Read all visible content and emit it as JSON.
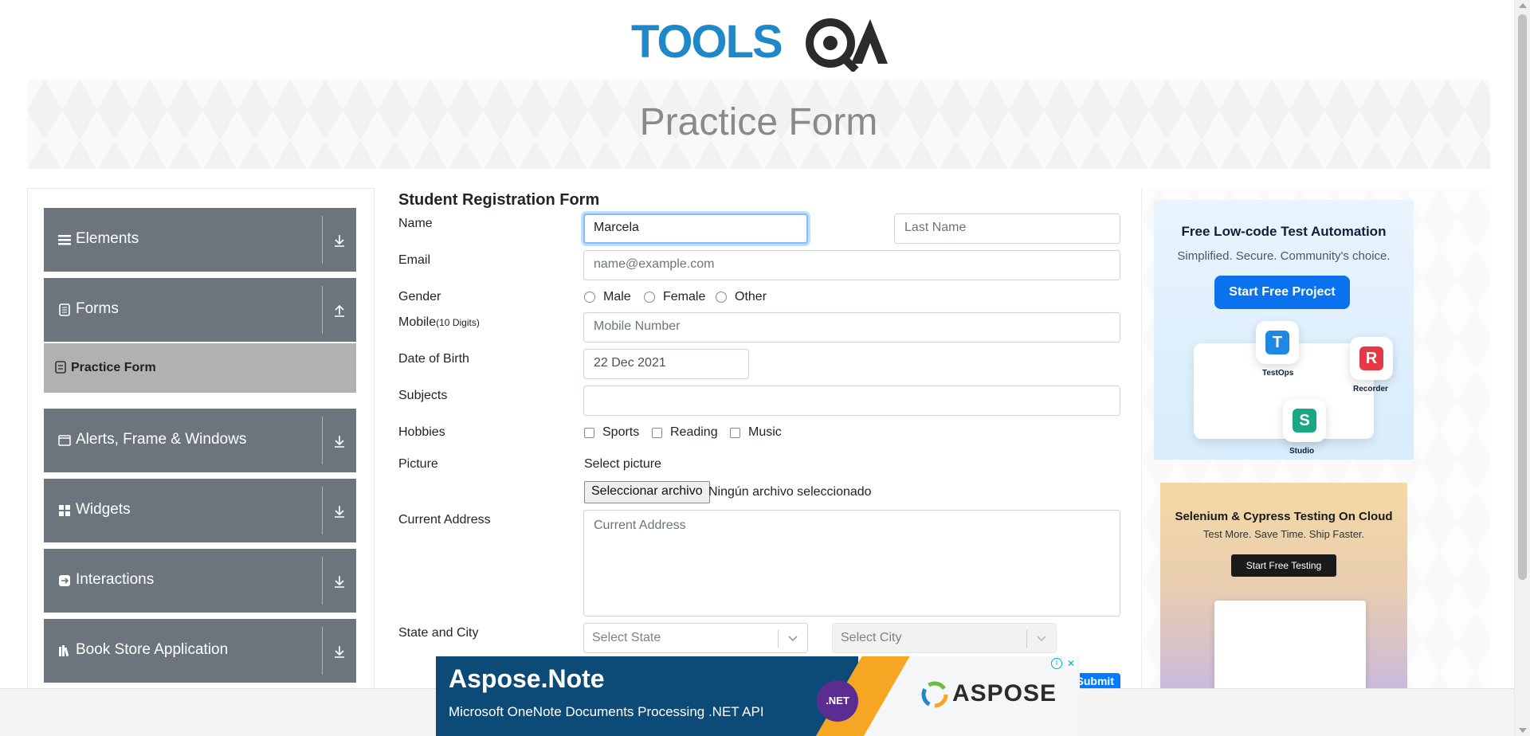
{
  "header": {
    "logo_text": "TOOLSQA",
    "page_title": "Practice Form"
  },
  "sidebar": {
    "groups": [
      {
        "label": "Elements",
        "icon": "hamburger-icon",
        "arrow": "download-icon"
      },
      {
        "label": "Forms",
        "icon": "document-icon",
        "arrow": "upload-icon"
      },
      {
        "label": "Alerts, Frame & Windows",
        "icon": "window-icon",
        "arrow": "download-icon"
      },
      {
        "label": "Widgets",
        "icon": "grid-icon",
        "arrow": "download-icon"
      },
      {
        "label": "Interactions",
        "icon": "interaction-icon",
        "arrow": "download-icon"
      },
      {
        "label": "Book Store Application",
        "icon": "books-icon",
        "arrow": "download-icon"
      }
    ],
    "active_item": {
      "label": "Practice Form",
      "icon": "form-icon"
    }
  },
  "form": {
    "title": "Student Registration Form",
    "name_label": "Name",
    "first_name_value": "Marcela",
    "last_name_placeholder": "Last Name",
    "email_label": "Email",
    "email_placeholder": "name@example.com",
    "gender_label": "Gender",
    "genders": [
      "Male",
      "Female",
      "Other"
    ],
    "mobile_label": "Mobile",
    "mobile_hint": "(10 Digits)",
    "mobile_placeholder": "Mobile Number",
    "dob_label": "Date of Birth",
    "dob_value": "22 Dec 2021",
    "subjects_label": "Subjects",
    "subjects_value": "",
    "hobbies_label": "Hobbies",
    "hobbies": [
      "Sports",
      "Reading",
      "Music"
    ],
    "picture_label": "Picture",
    "select_picture_label": "Select picture",
    "file_button": "Seleccionar archivo",
    "file_status": "Ningún archivo seleccionado",
    "address_label": "Current Address",
    "address_placeholder": "Current Address",
    "state_city_label": "State and City",
    "state_placeholder": "Select State",
    "city_placeholder": "Select City",
    "submit_label": "Submit"
  },
  "ads": {
    "testproject": {
      "title": "Free Low-code Test Automation",
      "subtitle": "Simplified. Secure. Community's choice.",
      "button": "Start Free Project",
      "badges": [
        "TestOps",
        "Recorder",
        "Studio"
      ]
    },
    "cloud_testing": {
      "title": "Selenium & Cypress Testing On Cloud",
      "subtitle": "Test More. Save Time. Ship Faster.",
      "button": "Start Free Testing"
    },
    "aspose": {
      "title": "Aspose.Note",
      "subtitle": "Microsoft OneNote Documents Processing .NET API",
      "badge": ".NET",
      "brand": "ASPOSE"
    }
  },
  "colors": {
    "sidebar_group": "#6c757d",
    "sidebar_active": "#b1b1b1",
    "focus_border": "#80bdff",
    "primary": "#007bff",
    "logo_blue": "#1e88c8"
  }
}
